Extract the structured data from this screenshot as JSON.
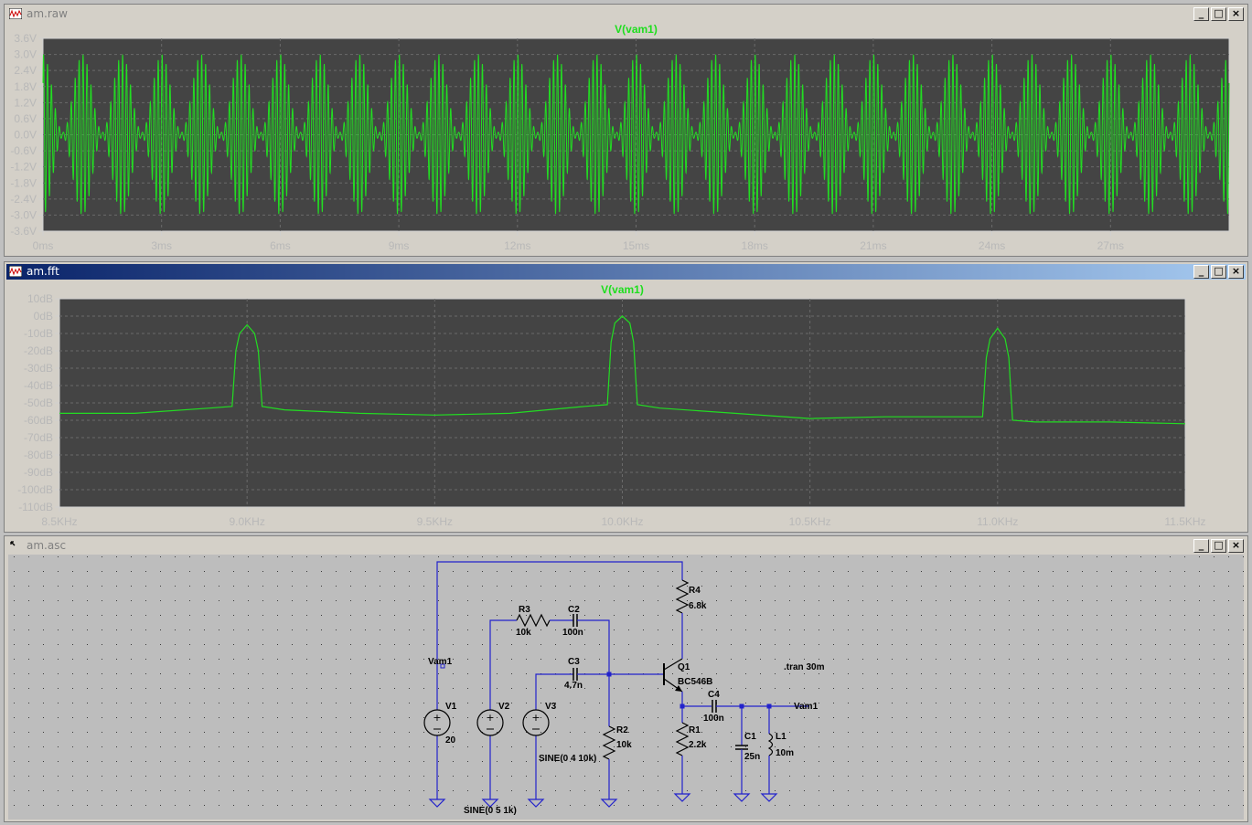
{
  "colors": {
    "plot_bg": "#444444",
    "trace": "#22dd22",
    "grid": "#6a6a6a",
    "wire": "#2222cc",
    "schematic_bg": "#bdbdbd"
  },
  "windows": {
    "raw": {
      "title": "am.raw",
      "trace_name": "V(vam1)"
    },
    "fft": {
      "title": "am.fft",
      "trace_name": "V(vam1)"
    },
    "asc": {
      "title": "am.asc"
    }
  },
  "window_buttons": {
    "minimize": "_",
    "maximize": "□",
    "close": "×"
  },
  "chart_data": [
    {
      "type": "line",
      "title": "V(vam1)",
      "xlabel": "",
      "ylabel": "",
      "xlim": [
        0,
        30
      ],
      "ylim": [
        -3.6,
        3.6
      ],
      "x_tick_labels": [
        "0ms",
        "3ms",
        "6ms",
        "9ms",
        "12ms",
        "15ms",
        "18ms",
        "21ms",
        "24ms",
        "27ms"
      ],
      "y_tick_labels": [
        "3.6V",
        "3.0V",
        "2.4V",
        "1.8V",
        "1.2V",
        "0.6V",
        "0.0V",
        "-0.6V",
        "-1.2V",
        "-1.8V",
        "-2.4V",
        "-3.0V",
        "-3.6V"
      ],
      "grid": true,
      "series": [
        {
          "name": "V(vam1)",
          "carrier_khz": 10,
          "modulation_khz": 1,
          "peak_amplitude": 3.0,
          "description_of_waveform": ""
        }
      ]
    },
    {
      "type": "line",
      "title": "V(vam1)",
      "xlabel": "",
      "ylabel": "",
      "xlim": [
        8.5,
        11.5
      ],
      "ylim": [
        -110,
        10
      ],
      "x_tick_labels": [
        "8.5KHz",
        "9.0KHz",
        "9.5KHz",
        "10.0KHz",
        "10.5KHz",
        "11.0KHz",
        "11.5KHz"
      ],
      "y_tick_labels": [
        "10dB",
        "0dB",
        "-10dB",
        "-20dB",
        "-30dB",
        "-40dB",
        "-50dB",
        "-60dB",
        "-70dB",
        "-80dB",
        "-90dB",
        "-100dB",
        "-110dB"
      ],
      "grid": true,
      "series": [
        {
          "name": "V(vam1)",
          "x": [
            8.5,
            8.7,
            8.9,
            8.96,
            8.97,
            8.98,
            9.0,
            9.02,
            9.03,
            9.04,
            9.1,
            9.3,
            9.5,
            9.7,
            9.9,
            9.96,
            9.97,
            9.98,
            10.0,
            10.02,
            10.03,
            10.04,
            10.1,
            10.3,
            10.5,
            10.7,
            10.9,
            10.96,
            10.97,
            10.98,
            11.0,
            11.02,
            11.03,
            11.04,
            11.1,
            11.3,
            11.5
          ],
          "y": [
            -56,
            -56,
            -53,
            -52,
            -20,
            -10,
            -5,
            -10,
            -20,
            -52,
            -54,
            -56,
            -57,
            -56,
            -52,
            -51,
            -15,
            -4,
            0,
            -4,
            -15,
            -51,
            -53,
            -56,
            -59,
            -58,
            -58,
            -58,
            -24,
            -13,
            -7,
            -13,
            -24,
            -60,
            -61,
            -61,
            -62
          ]
        }
      ]
    }
  ],
  "schematic": {
    "labels": {
      "r4": "R4",
      "r4_val": "6.8k",
      "r3": "R3",
      "r3_val": "10k",
      "c2": "C2",
      "c2_val": "100n",
      "c3": "C3",
      "c3_val": "4.7n",
      "q1": "Q1",
      "q1_val": "BC546B",
      "tran": ".tran 30m",
      "vam1_top": "Vam1",
      "v1": "V1",
      "v1_val": "20",
      "v2": "V2",
      "v3": "V3",
      "c4": "C4",
      "c4_val": "100n",
      "vam1_out": "Vam1",
      "r2": "R2",
      "r2_val": "10k",
      "r1": "R1",
      "r1_val": "2.2k",
      "c1": "C1",
      "c1_val": "25n",
      "l1": "L1",
      "l1_val": "10m",
      "v3_val": "SINE(0 4 10k)",
      "v2_val": "SINE(0 5 1k)"
    }
  }
}
